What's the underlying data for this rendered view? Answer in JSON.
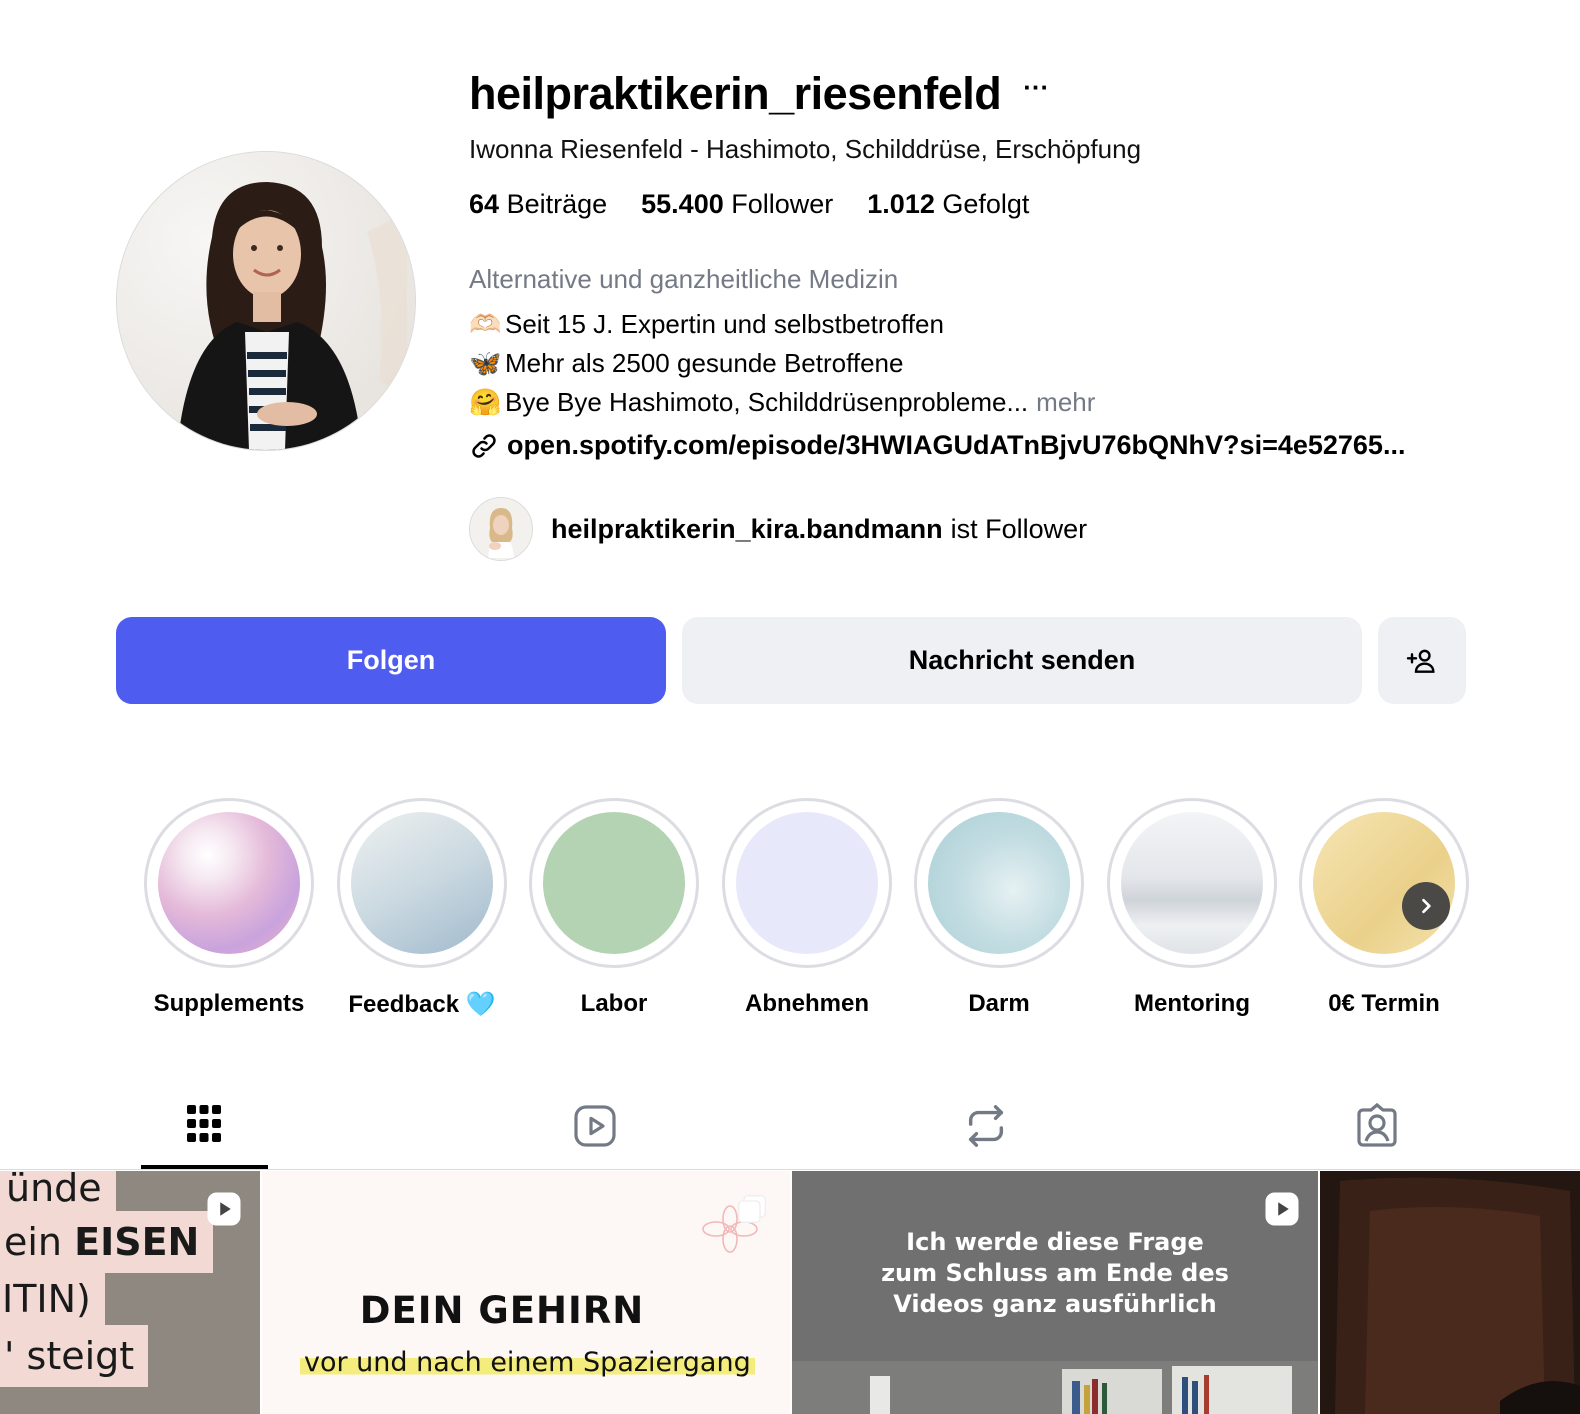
{
  "profile": {
    "username": "heilpraktikerin_riesenfeld",
    "more_label": "···",
    "full_name": "Iwonna Riesenfeld - Hashimoto, Schilddrüse, Erschöpfung",
    "stats": {
      "posts_count": "64",
      "posts_label": "Beiträge",
      "followers_count": "55.400",
      "followers_label": "Follower",
      "following_count": "1.012",
      "following_label": "Gefolgt"
    },
    "category": "Alternative und ganzheitliche Medizin",
    "bio": [
      {
        "emoji": "🫶🏻",
        "text": "Seit 15 J. Expertin und selbstbetroffen"
      },
      {
        "emoji": "🦋",
        "text": "Mehr als 2500 gesunde Betroffene"
      },
      {
        "emoji": "🤗",
        "text": "Bye Bye Hashimoto, Schilddrüsenprobleme..."
      }
    ],
    "bio_more": "mehr",
    "link": "open.spotify.com/episode/3HWIAGUdATnBjvU76bQNhV?si=4e52765...",
    "followed_by": {
      "username": "heilpraktikerin_kira.bandmann",
      "suffix": "ist Follower"
    }
  },
  "actions": {
    "follow": "Folgen",
    "message": "Nachricht senden",
    "add_user_icon": "person-add-icon"
  },
  "highlights": [
    {
      "label": "Supplements",
      "color": "#e9b7d8"
    },
    {
      "label": "Feedback 🩵",
      "color": "#c9d8e4"
    },
    {
      "label": "Labor",
      "color": "#b3d3b2"
    },
    {
      "label": "Abnehmen",
      "color": "#e8e8fb"
    },
    {
      "label": "Darm",
      "color": "#c4dfe3"
    },
    {
      "label": "Mentoring",
      "color": "#e3e6ea"
    },
    {
      "label": "0€ Termin",
      "color": "#f3dfa3"
    }
  ],
  "tabs": [
    {
      "name": "posts-grid-icon",
      "active": true
    },
    {
      "name": "reels-icon",
      "active": false
    },
    {
      "name": "reposts-icon",
      "active": false
    },
    {
      "name": "tagged-icon",
      "active": false
    }
  ],
  "grid": {
    "tile1": {
      "lines": [
        "ünde",
        "ein EISEN",
        "ITIN)",
        "' steigt"
      ],
      "bold_word": "EISEN"
    },
    "tile2": {
      "title": "DEIN GEHIRN",
      "subtitle": "vor und nach einem Spaziergang"
    },
    "tile3": {
      "lines": [
        "Ich werde diese Frage",
        "zum Schluss am Ende des",
        "Videos ganz ausführlich"
      ]
    }
  },
  "colors": {
    "follow_button": "#4f5cf0",
    "secondary_button": "#eff0f4",
    "muted_text": "#737a86"
  }
}
